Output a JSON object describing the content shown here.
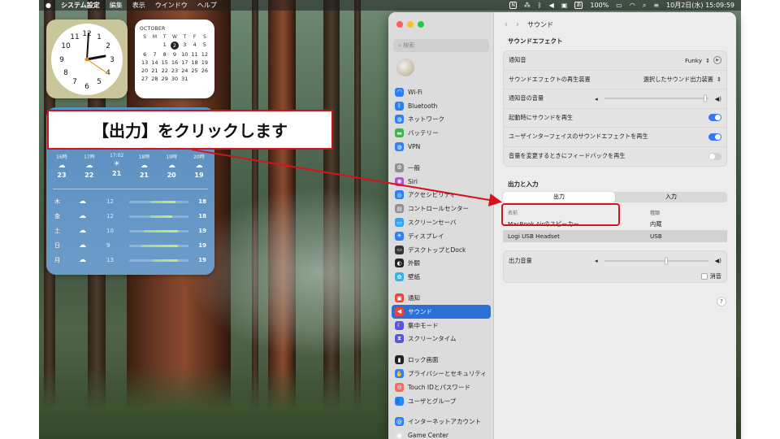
{
  "menubar": {
    "app": "システム設定",
    "menus": [
      "編集",
      "表示",
      "ウインドウ",
      "ヘルプ"
    ],
    "tray_n": "N",
    "battery": "100%",
    "ime": "あ",
    "datetime": "10月2日(水) 15:09:59"
  },
  "calendar": {
    "month": "OCTOBER",
    "weekdays": [
      "S",
      "M",
      "T",
      "W",
      "T",
      "F",
      "S"
    ],
    "days": [
      "",
      "",
      "1",
      "2",
      "3",
      "4",
      "5",
      "6",
      "7",
      "8",
      "9",
      "10",
      "11",
      "12",
      "13",
      "14",
      "15",
      "16",
      "17",
      "18",
      "19",
      "20",
      "21",
      "22",
      "23",
      "24",
      "25",
      "26",
      "27",
      "28",
      "29",
      "30",
      "31",
      "",
      ""
    ],
    "today": "2"
  },
  "weather": {
    "hourly": [
      {
        "time": "16時",
        "temp": "23"
      },
      {
        "time": "17時",
        "temp": "22"
      },
      {
        "time": "17:02",
        "temp": "21"
      },
      {
        "time": "18時",
        "temp": "21"
      },
      {
        "time": "19時",
        "temp": "20"
      },
      {
        "time": "20時",
        "temp": "19"
      }
    ],
    "daily": [
      {
        "day": "木",
        "low": "12",
        "high": "18",
        "bar_start": 0.35,
        "bar_end": 0.78
      },
      {
        "day": "金",
        "low": "12",
        "high": "18",
        "bar_start": 0.35,
        "bar_end": 0.72
      },
      {
        "day": "土",
        "low": "10",
        "high": "19",
        "bar_start": 0.25,
        "bar_end": 0.82
      },
      {
        "day": "日",
        "low": "9",
        "high": "19",
        "bar_start": 0.2,
        "bar_end": 0.82
      },
      {
        "day": "月",
        "low": "13",
        "high": "19",
        "bar_start": 0.4,
        "bar_end": 0.82
      }
    ]
  },
  "callout": {
    "text": "【出力】をクリックします"
  },
  "sidebar": {
    "search_placeholder": "検索",
    "items": [
      {
        "label": "Wi-Fi",
        "color": "#2f7ff0",
        "glyph": "◠"
      },
      {
        "label": "Bluetooth",
        "color": "#2f7ff0",
        "glyph": "ᛒ"
      },
      {
        "label": "ネットワーク",
        "color": "#2f7ff0",
        "glyph": "◍"
      },
      {
        "label": "バッテリー",
        "color": "#3cb44b",
        "glyph": "▬"
      },
      {
        "label": "VPN",
        "color": "#2f7ff0",
        "glyph": "◍"
      },
      {
        "label": "一般",
        "color": "#8e8e93",
        "glyph": "⚙"
      },
      {
        "label": "Siri",
        "color": "#b050d0",
        "glyph": "◉"
      },
      {
        "label": "アクセシビリティ",
        "color": "#2f7ff0",
        "glyph": "◎"
      },
      {
        "label": "コントロールセンター",
        "color": "#8e8e93",
        "glyph": "▤"
      },
      {
        "label": "スクリーンセーバ",
        "color": "#3aa0e8",
        "glyph": "▭"
      },
      {
        "label": "ディスプレイ",
        "color": "#2f7ff0",
        "glyph": "☀"
      },
      {
        "label": "デスクトップとDock",
        "color": "#333333",
        "glyph": "▭"
      },
      {
        "label": "外観",
        "color": "#222222",
        "glyph": "◐"
      },
      {
        "label": "壁紙",
        "color": "#35b0e8",
        "glyph": "✿"
      },
      {
        "label": "通知",
        "color": "#e8453c",
        "glyph": "▣"
      },
      {
        "label": "サウンド",
        "color": "#e8453c",
        "glyph": "◀"
      },
      {
        "label": "集中モード",
        "color": "#5856d6",
        "glyph": "☾"
      },
      {
        "label": "スクリーンタイム",
        "color": "#5856d6",
        "glyph": "⧗"
      },
      {
        "label": "ロック画面",
        "color": "#222222",
        "glyph": "▮"
      },
      {
        "label": "プライバシーとセキュリティ",
        "color": "#2f7ff0",
        "glyph": "✋"
      },
      {
        "label": "Touch IDとパスワード",
        "color": "#ef6a6a",
        "glyph": "◎"
      },
      {
        "label": "ユーザとグループ",
        "color": "#2f7ff0",
        "glyph": "👥"
      },
      {
        "label": "インターネットアカウント",
        "color": "#2f7ff0",
        "glyph": "@"
      },
      {
        "label": "Game Center",
        "color": "#e0e0e0",
        "glyph": "●"
      }
    ],
    "active": "サウンド"
  },
  "main": {
    "title": "サウンド",
    "effects_title": "サウンドエフェクト",
    "alert_sound_label": "通知音",
    "alert_sound_value": "Funky",
    "play_device_label": "サウンドエフェクトの再生装置",
    "play_device_value": "選択したサウンド出力装置",
    "alert_volume_label": "通知音の音量",
    "alert_volume": 0.97,
    "startup_label": "起動時にサウンドを再生",
    "startup_on": true,
    "ui_effects_label": "ユーザインターフェイスのサウンドエフェクトを再生",
    "ui_effects_on": true,
    "feedback_label": "音量を変更するときにフィードバックを再生",
    "feedback_on": false,
    "io_title": "出力と入力",
    "tab_output": "出力",
    "tab_input": "入力",
    "col_name": "名前",
    "col_type": "種類",
    "devices": [
      {
        "name": "MacBook Airのスピーカー",
        "type": "内蔵"
      },
      {
        "name": "Logi USB Headset",
        "type": "USB"
      }
    ],
    "output_volume_label": "出力音量",
    "output_volume": 0.6,
    "mute_label": "消音",
    "help": "?"
  }
}
